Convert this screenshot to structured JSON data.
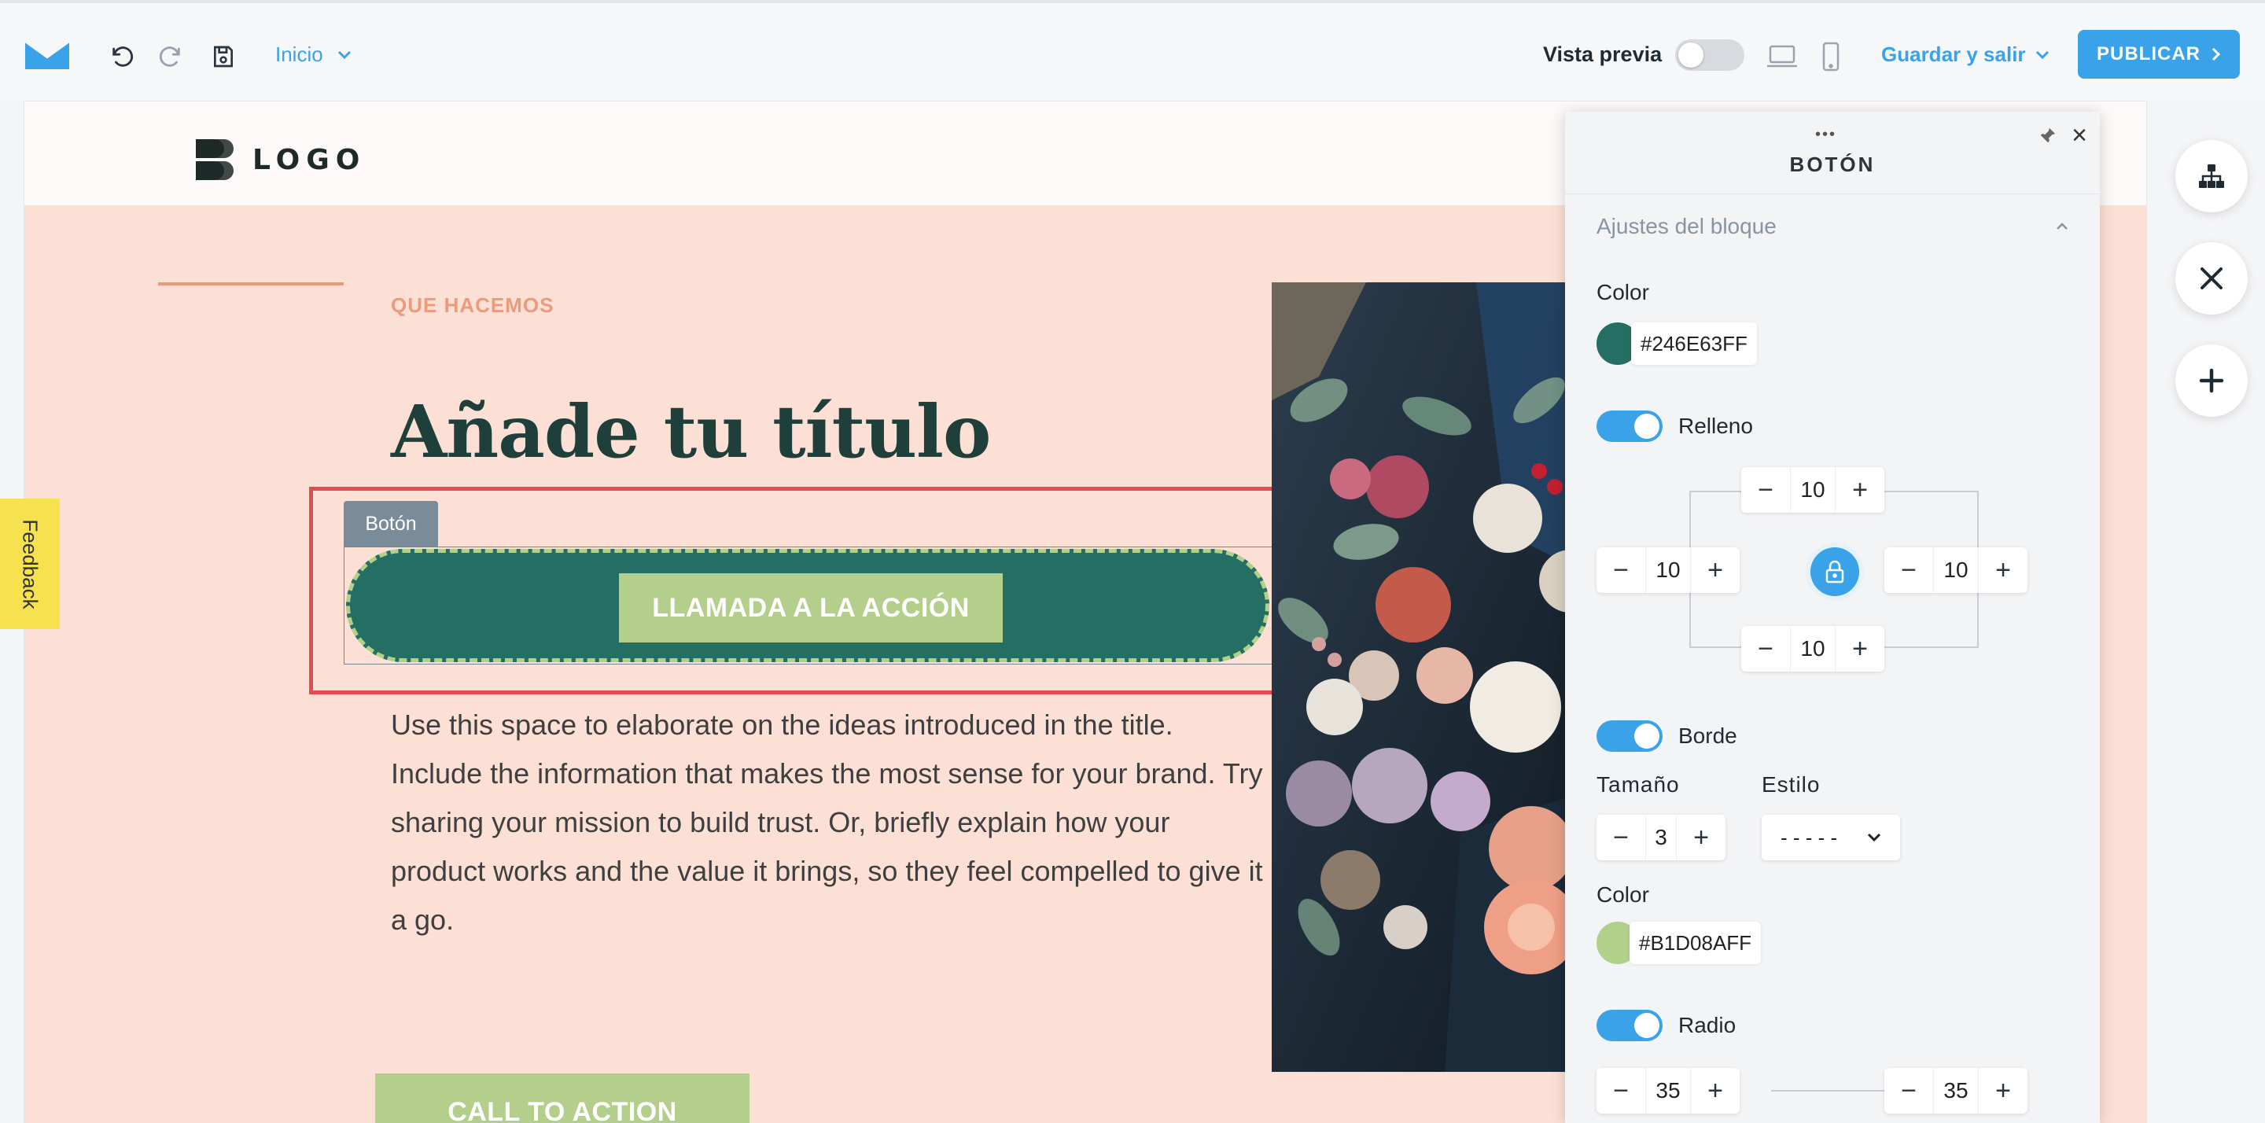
{
  "toolbar": {
    "page_selector": "Inicio",
    "preview_label": "Vista previa",
    "save_exit": "Guardar y salir",
    "publish": "PUBLICAR"
  },
  "site": {
    "logo_text": "LOGO",
    "eyebrow": "QUE HACEMOS",
    "title": "Añade tu título",
    "body": "Use this space to elaborate on the ideas introduced in the title. Include the information that makes the most sense for your brand. Try sharing your mission to build trust. Or, briefly explain how your product works and the value it brings, so they feel compelled to give it a go.",
    "selected_block_tag": "Botón",
    "cta_label": "LLAMADA A LA ACCIÓN",
    "cta2_label": "CALL TO ACTION"
  },
  "feedback_label": "Feedback",
  "panel": {
    "title": "BOTÓN",
    "section": "Ajustes del bloque",
    "color_label": "Color",
    "color_value": "#246E63FF",
    "padding_label": "Relleno",
    "padding": {
      "top": "10",
      "left": "10",
      "right": "10",
      "bottom": "10"
    },
    "border_label": "Borde",
    "size_label": "Tamaño",
    "size_value": "3",
    "style_label": "Estilo",
    "style_value": "- - - - -",
    "border_color_label": "Color",
    "border_color_value": "#B1D08AFF",
    "radius_label": "Radio",
    "radius": {
      "left": "35",
      "right": "35"
    }
  },
  "colors": {
    "accent": "#3aa2e8",
    "button_fill": "#246E63",
    "button_border": "#B1D08A",
    "canvas_bg": "#fde0d5",
    "selection": "#e44b4d"
  },
  "icons": [
    "mailbox-logo-icon",
    "undo-icon",
    "redo-icon",
    "save-icon",
    "chevron-down-icon",
    "desktop-icon",
    "mobile-icon",
    "chevron-right-icon",
    "pin-icon",
    "close-icon",
    "lock-icon",
    "sitemap-icon",
    "close-x-icon",
    "plus-icon"
  ]
}
